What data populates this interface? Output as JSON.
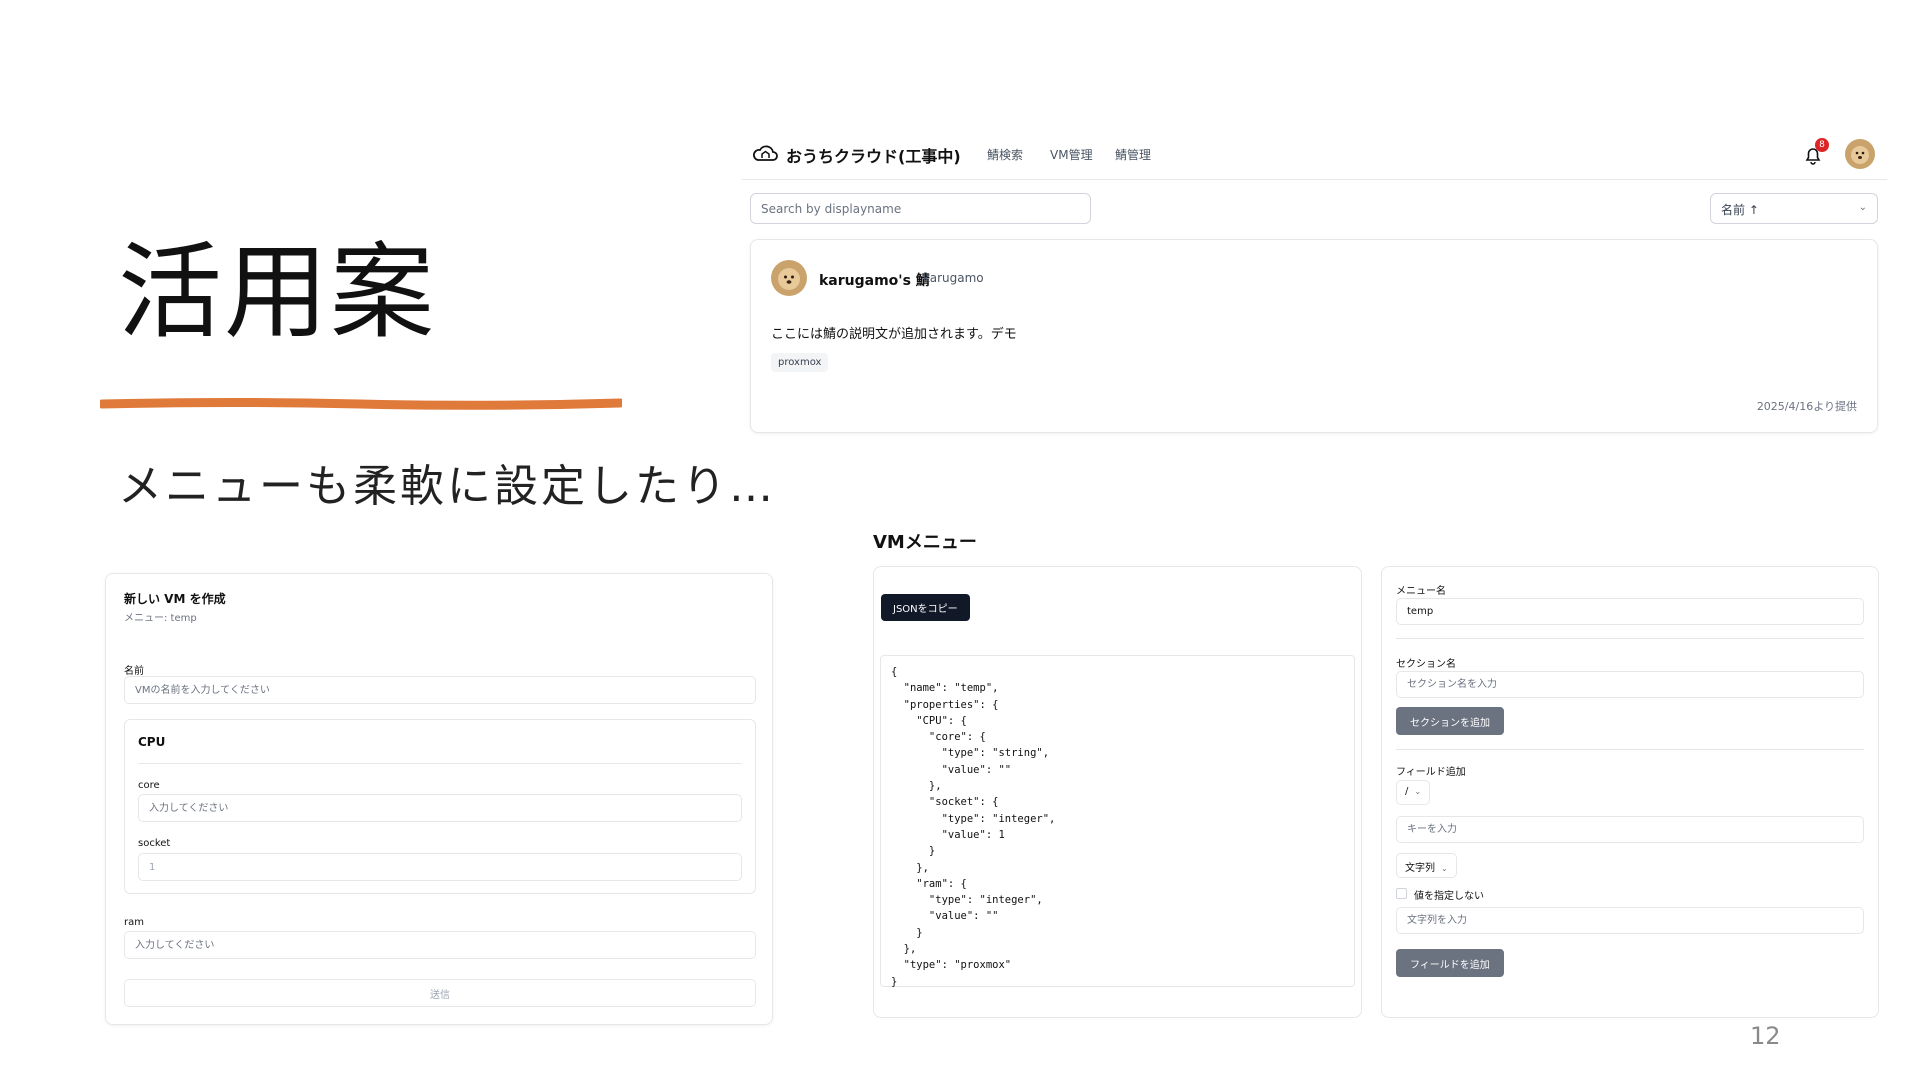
{
  "slide": {
    "title": "活用案",
    "subtitle": "メニューも柔軟に設定したり…",
    "page_number": "12",
    "accent_color": "#e07a3a"
  },
  "app": {
    "title": "おうちクラウド(工事中)",
    "nav": [
      "鯖検索",
      "VM管理",
      "鯖管理"
    ],
    "notification_count": "8",
    "search_placeholder": "Search by displayname",
    "sort_label": "名前 ↑",
    "card": {
      "owner": "karugamo's 鯖",
      "username": "karugamo",
      "description": "ここには鯖の説明文が追加されます。デモ",
      "tag": "proxmox",
      "date": "2025/4/16より提供"
    }
  },
  "form": {
    "title": "新しい VM を作成",
    "subtitle": "メニュー: temp",
    "name_label": "名前",
    "name_placeholder": "VMの名前を入力してください",
    "cpu_section": "CPU",
    "core_label": "core",
    "core_placeholder": "入力してください",
    "socket_label": "socket",
    "socket_value": "1",
    "ram_label": "ram",
    "ram_placeholder": "入力してください",
    "submit_label": "送信"
  },
  "vm_menu": {
    "title": "VMメニュー",
    "copy_button": "JSONをコピー",
    "json_text": "{\n  \"name\": \"temp\",\n  \"properties\": {\n    \"CPU\": {\n      \"core\": {\n        \"type\": \"string\",\n        \"value\": \"\"\n      },\n      \"socket\": {\n        \"type\": \"integer\",\n        \"value\": 1\n      }\n    },\n    \"ram\": {\n      \"type\": \"integer\",\n      \"value\": \"\"\n    }\n  },\n  \"type\": \"proxmox\"\n}",
    "editor": {
      "menu_name_label": "メニュー名",
      "menu_name_value": "temp",
      "section_label": "セクション名",
      "section_placeholder": "セクション名を入力",
      "add_section_button": "セクションを追加",
      "add_field_label": "フィールド追加",
      "path_select": "/",
      "key_placeholder": "キーを入力",
      "type_select": "文字列",
      "nullable_label": "値を指定しない",
      "value_placeholder": "文字列を入力",
      "add_field_button": "フィールドを追加"
    }
  }
}
